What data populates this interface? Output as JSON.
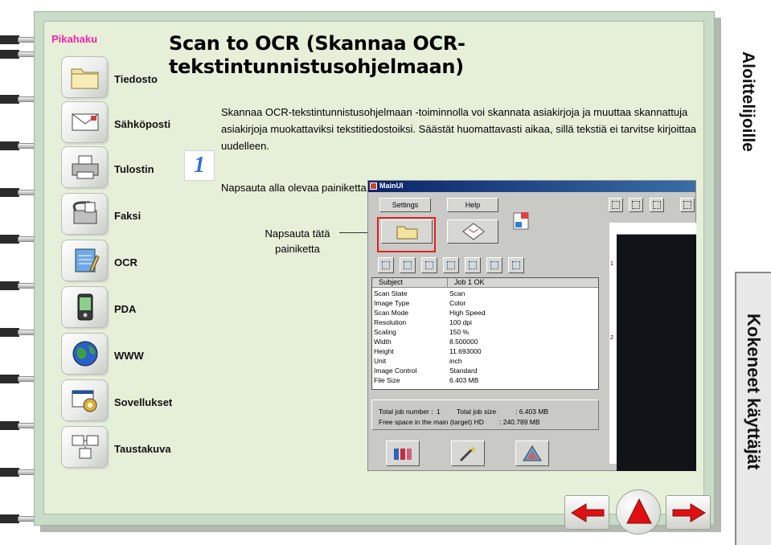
{
  "sidebar": {
    "title": "Pikahaku",
    "items": [
      {
        "label": "Tiedosto",
        "icon": "folder-icon"
      },
      {
        "label": "Sähköposti",
        "icon": "envelope-icon"
      },
      {
        "label": "Tulostin",
        "icon": "printer-icon"
      },
      {
        "label": "Faksi",
        "icon": "fax-icon"
      },
      {
        "label": "OCR",
        "icon": "notepad-icon"
      },
      {
        "label": "PDA",
        "icon": "pda-icon"
      },
      {
        "label": "WWW",
        "icon": "globe-icon"
      },
      {
        "label": "Sovellukset",
        "icon": "applications-icon"
      },
      {
        "label": "Taustakuva",
        "icon": "wallpaper-icon"
      }
    ]
  },
  "tabs": {
    "beginners": "Aloittelijoille",
    "experienced": "Kokeneet käyttäjät"
  },
  "content": {
    "title": "Scan to OCR (Skannaa OCR-tekstintunnistusohjelmaan)",
    "step_number": "1",
    "body": "Skannaa OCR-tekstintunnistusohjelmaan -toiminnolla voi skannata asiakirjoja ja muuttaa skannattuja asiakirjoja muokattaviksi tekstitiedostoiksi. Säästät huomattavasti aikaa, sillä tekstiä ei tarvitse kirjoittaa uudelleen.",
    "instruction": "Napsauta alla olevaa painiketta.",
    "callout": "Napsauta tätä painiketta"
  },
  "screenshot": {
    "window_title": "MainUI",
    "settings_label": "Settings",
    "help_label": "Help",
    "table_header_subject": "Subject",
    "table_header_job": "Job 1   OK",
    "rows": [
      {
        "key": "Scan State",
        "value": "Scan"
      },
      {
        "key": "Image Type",
        "value": "Color"
      },
      {
        "key": "Scan Mode",
        "value": "High Speed"
      },
      {
        "key": "Resolution",
        "value": "100 dpi"
      },
      {
        "key": "Scaling",
        "value": "150 %"
      },
      {
        "key": "Width",
        "value": "8.500000"
      },
      {
        "key": "Height",
        "value": "11.693000"
      },
      {
        "key": "Unit",
        "value": "inch"
      },
      {
        "key": "Image Control",
        "value": "Standard"
      },
      {
        "key": "File Size",
        "value": "6.403   MB"
      }
    ],
    "total_job_number_label": "Total job number  :",
    "total_job_number_value": "1",
    "total_job_size_label": "Total job size",
    "total_job_size_value": ":   6.403   MB",
    "free_space_label": "Free space in the main (target) HD",
    "free_space_value": ":   240.789 MB",
    "ruler_marks": [
      "1",
      "2"
    ]
  },
  "colors": {
    "frame": "#c8dcc8",
    "page": "#e6f0d9",
    "accent_pink": "#ff1fa8",
    "nav_red": "#e01010",
    "step_blue": "#2f6fd6"
  }
}
